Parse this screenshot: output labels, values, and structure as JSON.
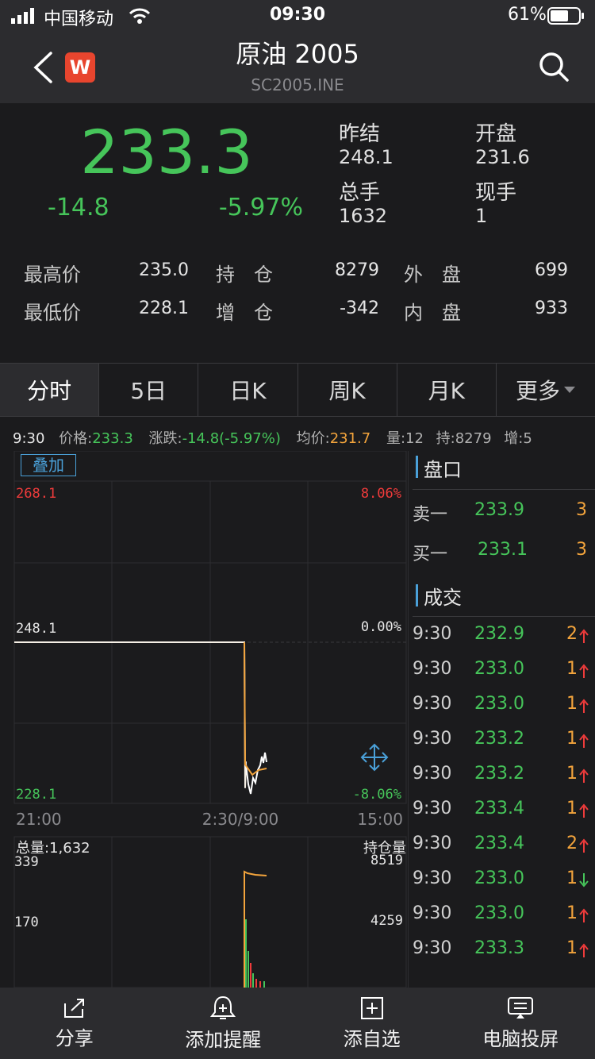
{
  "status_bar": {
    "carrier": "中国移动",
    "time": "09:30",
    "battery": "61%"
  },
  "nav": {
    "title": "原油 2005",
    "subtitle": "SC2005.INE",
    "logo_text": "W",
    "back_icon": "chevron-left-icon",
    "search_icon": "search-icon"
  },
  "quote": {
    "price": "233.3",
    "change": "-14.8",
    "change_pct": "-5.97%",
    "stats": [
      {
        "label": "昨结",
        "value": "248.1"
      },
      {
        "label": "开盘",
        "value": "231.6"
      },
      {
        "label": "总手",
        "value": "1632"
      },
      {
        "label": "现手",
        "value": "1"
      }
    ],
    "grid": [
      {
        "l1": "最高价",
        "v1": "235.0",
        "l2": "持　仓",
        "v2": "8279",
        "l3": "外　盘",
        "v3": "699"
      },
      {
        "l1": "最低价",
        "v1": "228.1",
        "l2": "增　仓",
        "v2": "-342",
        "l3": "内　盘",
        "v3": "933"
      }
    ]
  },
  "tabs": [
    "分时",
    "5日",
    "日K",
    "周K",
    "月K",
    "更多"
  ],
  "info_line": {
    "time": "9:30",
    "price_label": "价格:",
    "price": "233.3",
    "change_label": "涨跌:",
    "change": "-14.8(-5.97%)",
    "avg_label": "均价:",
    "avg": "231.7",
    "vol": "量:12",
    "hold": "持:8279",
    "add": "增:5"
  },
  "chart": {
    "overlay_button": "叠加",
    "y_left": [
      "268.1",
      "248.1",
      "228.1"
    ],
    "y_right": [
      "8.06%",
      "0.00%",
      "-8.06%"
    ],
    "x_labels": [
      "21:00",
      "2:30/9:00",
      "15:00"
    ],
    "vol_title": "总量:1,632",
    "vol_left": [
      "339",
      "170"
    ],
    "vol_right_title": "持仓量",
    "vol_right": [
      "8519",
      "4259"
    ]
  },
  "chart_data": {
    "type": "line",
    "title": "",
    "xlabel": "",
    "ylabel": "",
    "ylim": [
      228.1,
      268.1
    ],
    "x": [
      "21:00",
      "2:30/9:00",
      "15:00"
    ],
    "series": [
      {
        "values": [
          248.1,
          248.1,
          230.0,
          233.3
        ]
      }
    ]
  },
  "orderbook": {
    "title": "盘口",
    "rows": [
      {
        "label": "卖一",
        "price": "233.9",
        "qty": "3"
      },
      {
        "label": "买一",
        "price": "233.1",
        "qty": "3"
      }
    ]
  },
  "trades": {
    "title": "成交",
    "rows": [
      {
        "time": "9:30",
        "price": "232.9",
        "qty": "2",
        "dir": "up"
      },
      {
        "time": "9:30",
        "price": "233.0",
        "qty": "1",
        "dir": "up"
      },
      {
        "time": "9:30",
        "price": "233.0",
        "qty": "1",
        "dir": "up"
      },
      {
        "time": "9:30",
        "price": "233.2",
        "qty": "1",
        "dir": "up"
      },
      {
        "time": "9:30",
        "price": "233.2",
        "qty": "1",
        "dir": "up"
      },
      {
        "time": "9:30",
        "price": "233.4",
        "qty": "1",
        "dir": "up"
      },
      {
        "time": "9:30",
        "price": "233.4",
        "qty": "2",
        "dir": "up"
      },
      {
        "time": "9:30",
        "price": "233.0",
        "qty": "1",
        "dir": "down"
      },
      {
        "time": "9:30",
        "price": "233.0",
        "qty": "1",
        "dir": "up"
      },
      {
        "time": "9:30",
        "price": "233.3",
        "qty": "1",
        "dir": "up"
      }
    ]
  },
  "bottom_bar": [
    {
      "label": "分享",
      "icon": "share-icon"
    },
    {
      "label": "添加提醒",
      "icon": "bell-icon"
    },
    {
      "label": "添自选",
      "icon": "plus-square-icon"
    },
    {
      "label": "电脑投屏",
      "icon": "screen-cast-icon"
    }
  ]
}
